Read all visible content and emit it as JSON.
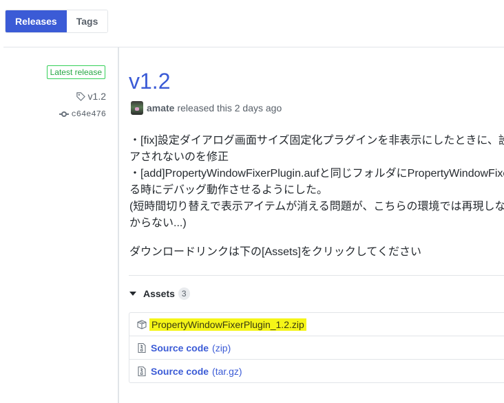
{
  "tabs": [
    {
      "label": "Releases",
      "active": true
    },
    {
      "label": "Tags",
      "active": false
    }
  ],
  "sidebar": {
    "latest_badge": "Latest release",
    "tag": "v1.2",
    "tag_icon": "tag-icon",
    "commit": "c64e476",
    "commit_icon": "git-commit-icon"
  },
  "release": {
    "title": "v1.2",
    "author": "amate",
    "released_text": "released this 2 days ago",
    "notes": [
      "・[fix]設定ダイアログ画面サイズ固定化プラグインを非表示にしたときに、設",
      "アされないのを修正",
      "・[add]PropertyWindowFixerPlugin.aufと同じフォルダにPropertyWindowFixe",
      "る時にデバッグ動作させるようにした。",
      "(短時間切り替えで表示アイテムが消える問題が、こちらの環境では再現しな",
      "からない...)"
    ],
    "download_note": "ダウンロードリンクは下の[Assets]をクリックしてください"
  },
  "assets": {
    "label": "Assets",
    "count": "3",
    "items": [
      {
        "name": "PropertyWindowFixerPlugin_1.2.zip",
        "suffix": "",
        "icon": "package-icon",
        "highlighted": true
      },
      {
        "name": "Source code",
        "suffix": "(zip)",
        "icon": "file-zip-icon",
        "highlighted": false
      },
      {
        "name": "Source code",
        "suffix": "(tar.gz)",
        "icon": "file-zip-icon",
        "highlighted": false
      }
    ]
  },
  "colors": {
    "accent": "#3b5bd6",
    "latest_green": "#28a745",
    "highlight": "#f5f518"
  }
}
